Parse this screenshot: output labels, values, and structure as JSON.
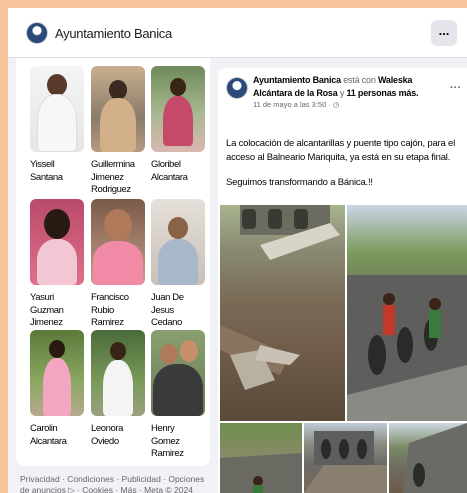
{
  "header": {
    "page_name": "Ayuntamiento Banica",
    "more_label": "..."
  },
  "friends": [
    {
      "name": "Yissell Santana"
    },
    {
      "name": "Guillermina Jimenez Rodriguez"
    },
    {
      "name": "Gloribel Alcantara"
    },
    {
      "name": "Yasuri Guzman Jimenez"
    },
    {
      "name": "Francisco Rubio Ramirez"
    },
    {
      "name": "Juan De Jesus Cedano"
    },
    {
      "name": "Carolin Alcantara"
    },
    {
      "name": "Leonora Oviedo"
    },
    {
      "name": "Henry Gomez Ramirez"
    }
  ],
  "footer": {
    "links": "Privacidad · Condiciones · Publicidad · Opciones de anuncios ▷ · Cookies · Más · Meta © 2024"
  },
  "post": {
    "author": "Ayuntamiento Banica",
    "with_text": "está con",
    "tagged": "Waleska Alcántara de la Rosa",
    "and_text": "y",
    "others": "11 personas más.",
    "timestamp": "11 de mayo a las 3:50 · ◷",
    "more_label": "···",
    "paragraph1": "La colocación de alcantarillas y puente tipo cajón, para el acceso al Balneario Mariquita, ya está en su etapa final.",
    "paragraph2": "Seguimos transformando a Bánica.!!"
  }
}
